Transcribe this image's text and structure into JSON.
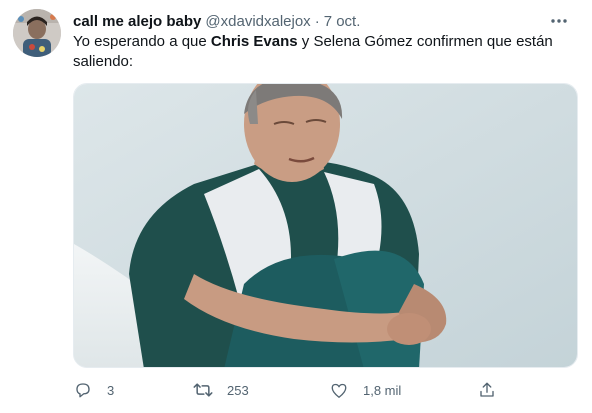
{
  "tweet": {
    "author": {
      "display_name": "call me alejo baby",
      "handle": "@xdavidxalejox",
      "separator": "·",
      "date": "7 oct."
    },
    "text": {
      "part1": "Yo esperando a que ",
      "bold": "Chris Evans",
      "part2": " y Selena Gómez confirmen que están saliendo:"
    },
    "media": {
      "description": "photo"
    },
    "actions": {
      "replies": "3",
      "retweets": "253",
      "likes": "1,8 mil"
    },
    "icons": {
      "avatar": "avatar",
      "more": "more-icon",
      "reply": "reply-icon",
      "retweet": "retweet-icon",
      "like": "heart-icon",
      "share": "share-icon"
    },
    "colors": {
      "text": "#0f1419",
      "secondary": "#536471",
      "background": "#ffffff"
    }
  }
}
